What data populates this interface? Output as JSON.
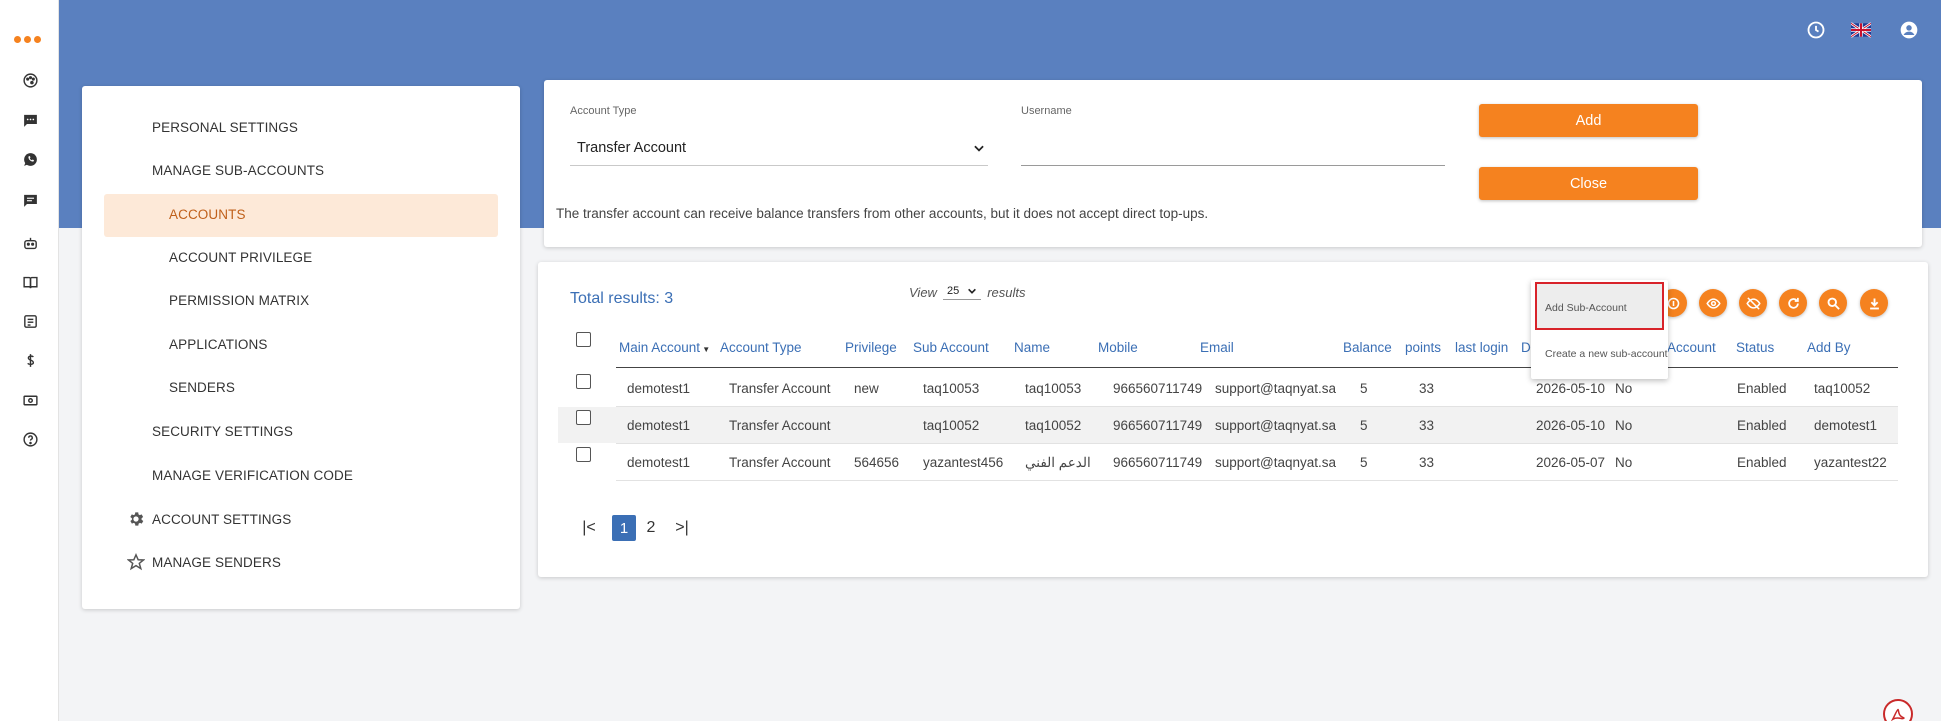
{
  "rail": {
    "icons": [
      "dashboard-icon",
      "sms-icon",
      "whatsapp-icon",
      "chat-icon",
      "bot-icon",
      "book-icon",
      "report-icon",
      "billing-icon",
      "money-icon",
      "help-icon"
    ]
  },
  "header": {
    "icons": [
      "clock-icon",
      "uk-flag-icon",
      "account-circle-icon"
    ]
  },
  "menu": {
    "personal_settings": "PERSONAL SETTINGS",
    "manage_sub_accounts": "MANAGE SUB-ACCOUNTS",
    "accounts": "ACCOUNTS",
    "account_privilege": "ACCOUNT PRIVILEGE",
    "permission_matrix": "PERMISSION MATRIX",
    "applications": "APPLICATIONS",
    "senders": "SENDERS",
    "security_settings": "SECURITY SETTINGS",
    "manage_verification_code": "MANAGE VERIFICATION CODE",
    "account_settings": "ACCOUNT SETTINGS",
    "manage_senders": "MANAGE SENDERS"
  },
  "form": {
    "account_type_label": "Account Type",
    "account_type_value": "Transfer Account",
    "username_label": "Username",
    "username_value": "",
    "add_label": "Add",
    "close_label": "Close",
    "note": "The transfer account can receive balance transfers from other accounts, but it does not accept direct top-ups."
  },
  "table": {
    "total": "Total results: 3",
    "view_label": "View",
    "per_page": "25",
    "results_label": "results",
    "headers": {
      "main_account": "Main Account",
      "account_type": "Account Type",
      "privilege": "Privilege",
      "sub_account": "Sub Account",
      "name": "Name",
      "mobile": "Mobile",
      "email": "Email",
      "balance": "Balance",
      "points": "points",
      "last_login": "last login",
      "d": "D",
      "account": "Account",
      "status": "Status",
      "add_by": "Add By"
    },
    "rows": [
      {
        "main": "demotest1",
        "type": "Transfer Account",
        "privilege": "new",
        "sub": "taq10053",
        "name": "taq10053",
        "mobile": "966560711749",
        "email": "support@taqnyat.sa",
        "balance": "5",
        "points": "33",
        "last_login": "",
        "date": "2026-05-10",
        "flag": "No",
        "status": "Enabled",
        "add_by": "taq10052"
      },
      {
        "main": "demotest1",
        "type": "Transfer Account",
        "privilege": "",
        "sub": "taq10052",
        "name": "taq10052",
        "mobile": "966560711749",
        "email": "support@taqnyat.sa",
        "balance": "5",
        "points": "33",
        "last_login": "",
        "date": "2026-05-10",
        "flag": "No",
        "status": "Enabled",
        "add_by": "demotest1"
      },
      {
        "main": "demotest1",
        "type": "Transfer Account",
        "privilege": "564656",
        "sub": "yazantest456",
        "name": "الدعم الفني",
        "mobile": "966560711749",
        "email": "support@taqnyat.sa",
        "balance": "5",
        "points": "33",
        "last_login": "",
        "date": "2026-05-07",
        "flag": "No",
        "status": "Enabled",
        "add_by": "yazantest22"
      }
    ],
    "toolbar_icons": [
      "sub-account-icon",
      "eye-icon",
      "eye-off-icon",
      "refresh-icon",
      "search-icon",
      "download-icon"
    ],
    "pagination": {
      "first": "|<",
      "pages": [
        "1",
        "2"
      ],
      "last": ">|",
      "current": "1"
    }
  },
  "popup": {
    "title": "Add Sub-Account",
    "description": "Create a new sub-account"
  },
  "colors": {
    "brand_blue": "#5a80bf",
    "accent_orange": "#f5821f",
    "link_blue": "#3b6fb5",
    "highlight_red": "#d8232a",
    "active_bg": "#fde9d8"
  }
}
